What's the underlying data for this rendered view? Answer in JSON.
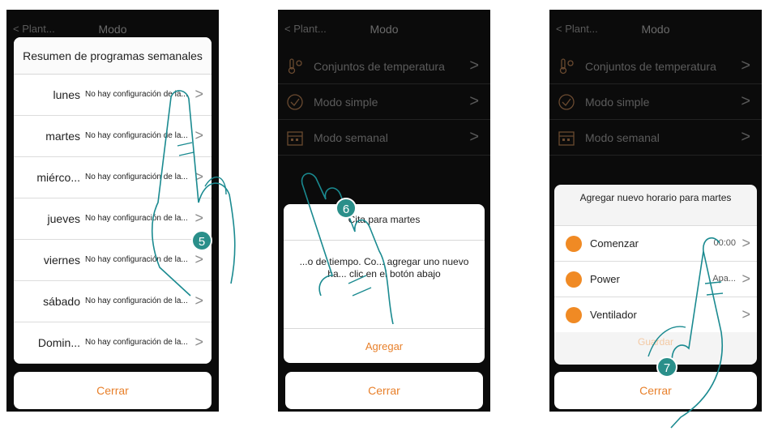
{
  "panel1": {
    "back_label": "Plant...",
    "title": "Modo",
    "sheet_title": "Resumen de programas semanales",
    "days": [
      {
        "name": "lunes",
        "status": "No hay configuración de la..."
      },
      {
        "name": "martes",
        "status": "No hay configuración de la..."
      },
      {
        "name": "miérco...",
        "status": "No hay configuración de la..."
      },
      {
        "name": "jueves",
        "status": "No hay configuración de la..."
      },
      {
        "name": "viernes",
        "status": "No hay configuración de la..."
      },
      {
        "name": "sábado",
        "status": "No hay configuración de la..."
      },
      {
        "name": "Domin...",
        "status": "No hay configuración de la..."
      }
    ],
    "close_label": "Cerrar",
    "step": "5"
  },
  "panel2": {
    "back_label": "Plant...",
    "title": "Modo",
    "menu": [
      {
        "label": "Conjuntos de temperatura",
        "icon": "thermometer-icon"
      },
      {
        "label": "Modo simple",
        "icon": "check-circle-icon"
      },
      {
        "label": "Modo semanal",
        "icon": "calendar-icon"
      }
    ],
    "dialog_title": "Cita para martes",
    "dialog_body": "...o de tiempo. Co... agregar uno nuevo ha... clic en el botón abajo",
    "add_label": "Agregar",
    "close_label": "Cerrar",
    "step": "6"
  },
  "panel3": {
    "back_label": "Plant...",
    "title": "Modo",
    "menu": [
      {
        "label": "Conjuntos de temperatura",
        "icon": "thermometer-icon"
      },
      {
        "label": "Modo simple",
        "icon": "check-circle-icon"
      },
      {
        "label": "Modo semanal",
        "icon": "calendar-icon"
      }
    ],
    "sheet_title": "Agregar nuevo horario para martes",
    "rows": [
      {
        "label": "Comenzar",
        "value": "00:00",
        "icon": "clock-icon"
      },
      {
        "label": "Power",
        "value": "Apa...",
        "icon": "power-icon"
      },
      {
        "label": "Ventilador",
        "value": "",
        "icon": "fan-icon"
      }
    ],
    "save_label": "Guardar",
    "close_label": "Cerrar",
    "step": "7"
  },
  "colors": {
    "accent": "#e8802b",
    "step_badge": "#2a8f8a",
    "hand_outline": "#1a8a90"
  }
}
